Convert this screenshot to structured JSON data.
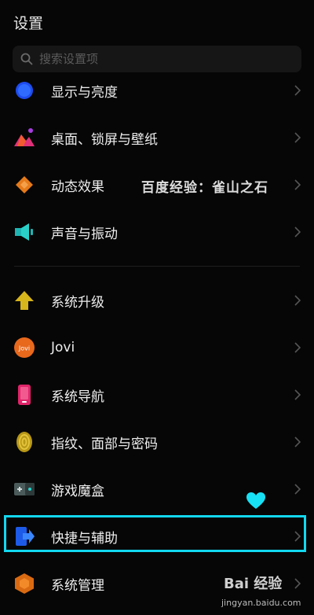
{
  "header": {
    "title": "设置"
  },
  "search": {
    "placeholder": "搜索设置项"
  },
  "items": [
    {
      "label": "显示与亮度",
      "icon": "display-brightness-icon"
    },
    {
      "label": "桌面、锁屏与壁纸",
      "icon": "wallpaper-icon"
    },
    {
      "label": "动态效果",
      "icon": "dynamic-effects-icon"
    },
    {
      "label": "声音与振动",
      "icon": "sound-icon"
    },
    {
      "label": "系统升级",
      "icon": "system-update-icon"
    },
    {
      "label": "Jovi",
      "icon": "jovi-icon",
      "icon_text": "Jovi"
    },
    {
      "label": "系统导航",
      "icon": "system-navigation-icon"
    },
    {
      "label": "指纹、面部与密码",
      "icon": "fingerprint-icon"
    },
    {
      "label": "游戏魔盒",
      "icon": "game-box-icon"
    },
    {
      "label": "快捷与辅助",
      "icon": "shortcuts-assist-icon"
    },
    {
      "label": "系统管理",
      "icon": "system-management-icon"
    }
  ],
  "watermark": {
    "text": "百度经验：雀山之石"
  },
  "overlay": {
    "highlight_color": "#12d8f0",
    "baidu_logo": "Bai 经验",
    "baidu_url": "jingyan.baidu.com"
  }
}
